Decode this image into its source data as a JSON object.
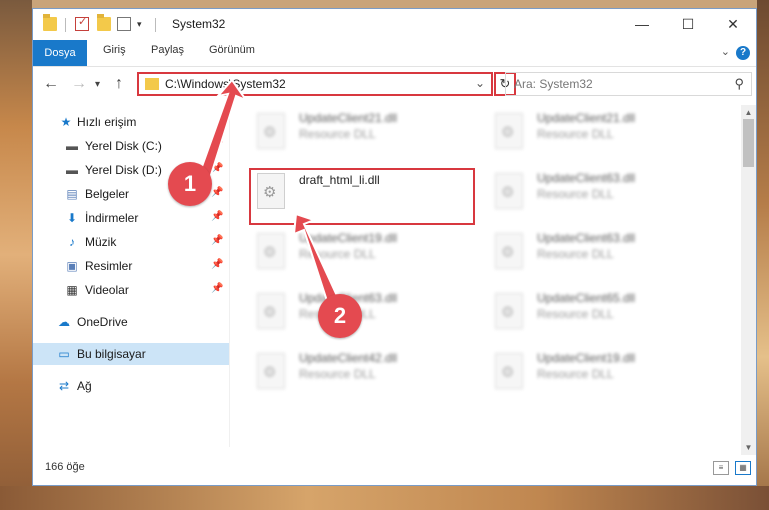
{
  "window": {
    "title": "System32",
    "minimize": "—",
    "maximize": "☐",
    "close": "✕"
  },
  "ribbon": {
    "tabs": [
      "Dosya",
      "Giriş",
      "Paylaş",
      "Görünüm"
    ],
    "help": "?",
    "collapse": "⌄"
  },
  "address": {
    "path": "C:\\Windows\\System32",
    "search_placeholder": "Ara: System32"
  },
  "sidebar": {
    "items": [
      {
        "label": "Hızlı erişim",
        "icon": "star-icon"
      },
      {
        "label": "Yerel Disk (C:)",
        "icon": "drive-icon"
      },
      {
        "label": "Yerel Disk (D:)",
        "icon": "drive-icon"
      },
      {
        "label": "Belgeler",
        "icon": "document-icon"
      },
      {
        "label": "İndirmeler",
        "icon": "download-icon"
      },
      {
        "label": "Müzik",
        "icon": "music-icon"
      },
      {
        "label": "Resimler",
        "icon": "picture-icon"
      },
      {
        "label": "Videolar",
        "icon": "video-icon"
      },
      {
        "label": "OneDrive",
        "icon": "cloud-icon"
      },
      {
        "label": "Bu bilgisayar",
        "icon": "computer-icon"
      },
      {
        "label": "Ağ",
        "icon": "network-icon"
      }
    ]
  },
  "files": {
    "highlighted": {
      "name": "draft_html_li.dll"
    },
    "blurred": [
      {
        "name": "UpdateClient21.dll",
        "type": "Resource DLL"
      },
      {
        "name": "UpdateClient21.dll",
        "type": "Resource DLL"
      },
      {
        "name": "UpdateClient63.dll",
        "type": "Resource DLL"
      },
      {
        "name": "UpdateClient19.dll",
        "type": "Resource DLL"
      },
      {
        "name": "UpdateClient63.dll",
        "type": "Resource DLL"
      },
      {
        "name": "UpdateClient63.dll",
        "type": "Resource DLL"
      },
      {
        "name": "UpdateClient65.dll",
        "type": "Resource DLL"
      },
      {
        "name": "UpdateClient42.dll",
        "type": "Resource DLL"
      },
      {
        "name": "UpdateClient19.dll",
        "type": "Resource DLL"
      }
    ]
  },
  "status": {
    "count": "166 öğe"
  },
  "annotations": {
    "step1": "1",
    "step2": "2"
  },
  "colors": {
    "accent": "#1979ca",
    "highlight_red": "#d8383f",
    "callout_red": "#e44a50"
  }
}
